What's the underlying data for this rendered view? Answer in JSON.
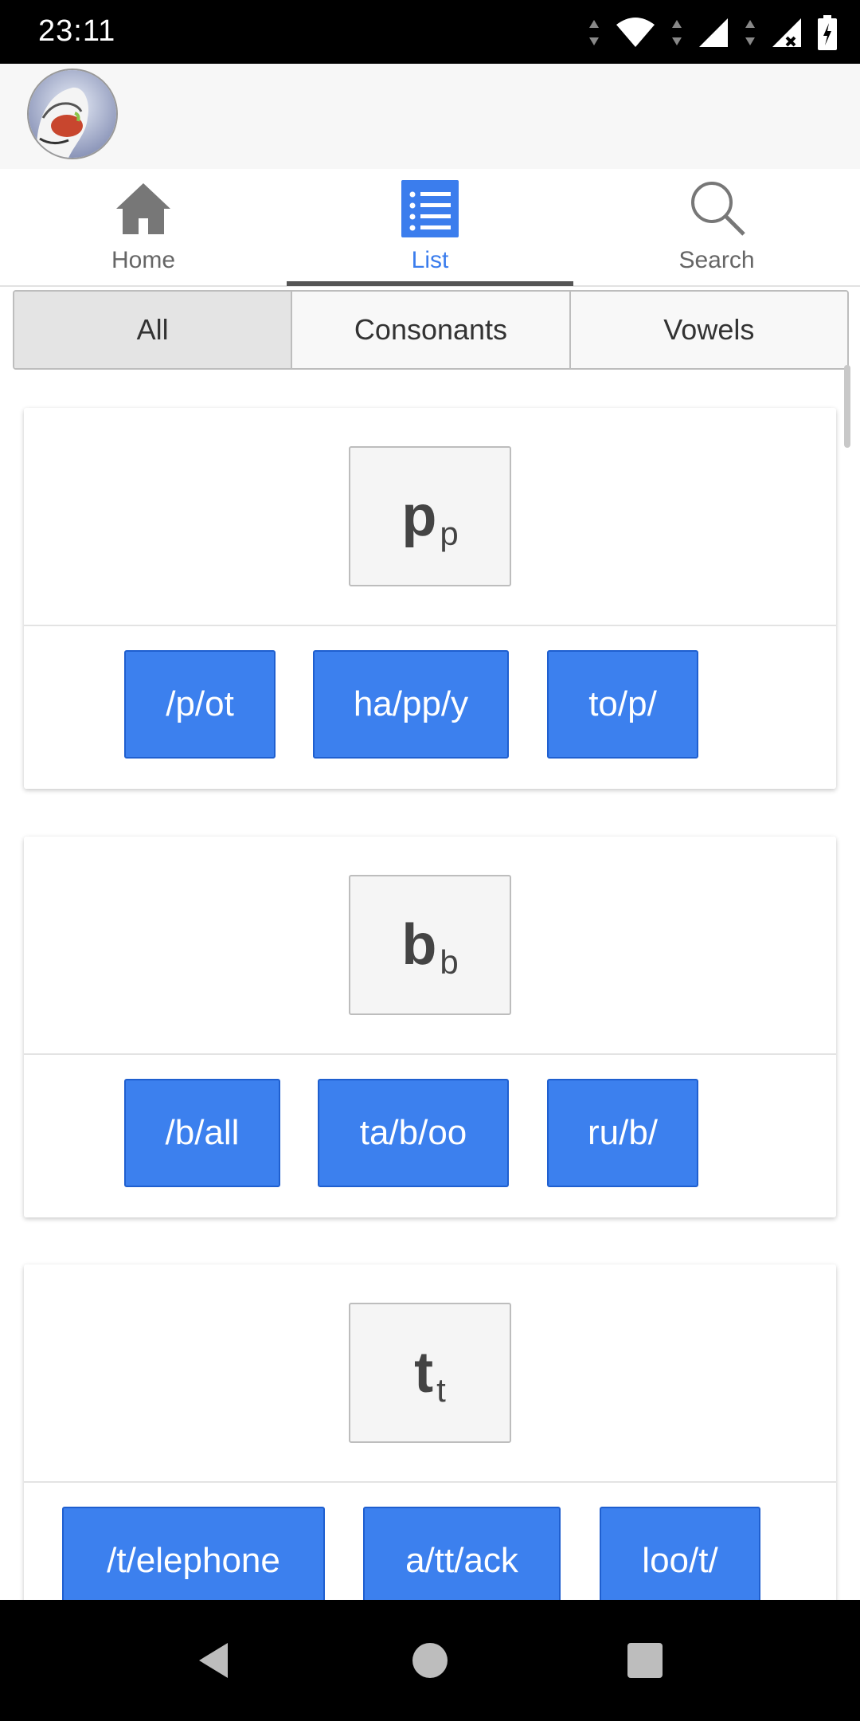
{
  "status": {
    "time": "23:11"
  },
  "tabs": [
    {
      "label": "Home",
      "icon": "home-icon"
    },
    {
      "label": "List",
      "icon": "list-icon",
      "active": true
    },
    {
      "label": "Search",
      "icon": "search-icon"
    }
  ],
  "filters": [
    {
      "label": "All",
      "active": true
    },
    {
      "label": "Consonants"
    },
    {
      "label": "Vowels"
    }
  ],
  "cards": [
    {
      "symbol": "p",
      "sub": "p",
      "words": [
        "/p/ot",
        "ha/pp/y",
        "to/p/"
      ]
    },
    {
      "symbol": "b",
      "sub": "b",
      "words": [
        "/b/all",
        "ta/b/oo",
        "ru/b/"
      ]
    },
    {
      "symbol": "t",
      "sub": "t",
      "words": [
        "/t/elephone",
        "a/tt/ack",
        "loo/t/"
      ]
    }
  ],
  "colors": {
    "accent": "#3c80ee",
    "tab_active": "#3b7ded",
    "text": "#333333"
  }
}
